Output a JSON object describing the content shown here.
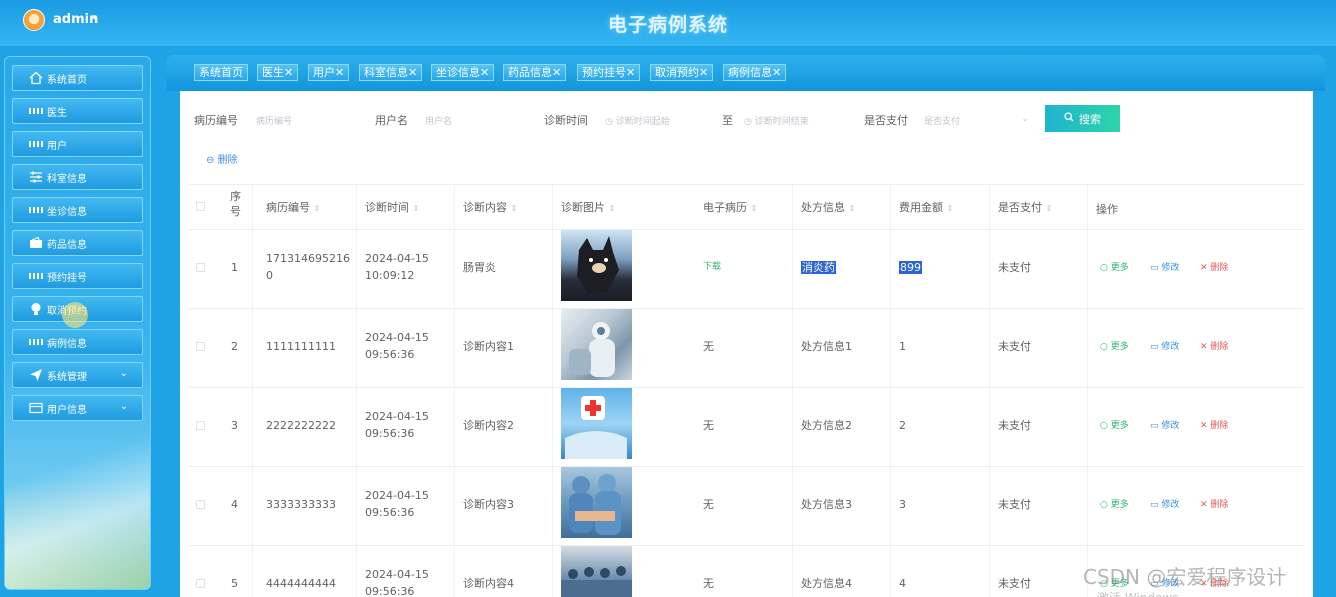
{
  "header": {
    "user": "admin",
    "caret": "▾",
    "title": "电子病例系统"
  },
  "sidebar": {
    "items": [
      {
        "label": "系统首页",
        "icon": "home-icon"
      },
      {
        "label": "医生",
        "icon": "grid-icon"
      },
      {
        "label": "用户",
        "icon": "grid-icon"
      },
      {
        "label": "科室信息",
        "icon": "sliders-icon"
      },
      {
        "label": "坐诊信息",
        "icon": "grid-icon"
      },
      {
        "label": "药品信息",
        "icon": "wallet-icon"
      },
      {
        "label": "预约挂号",
        "icon": "grid-icon"
      },
      {
        "label": "取消预约",
        "icon": "bulb-icon"
      },
      {
        "label": "病例信息",
        "icon": "grid-icon"
      },
      {
        "label": "系统管理",
        "icon": "send-icon",
        "expandable": true
      },
      {
        "label": "用户信息",
        "icon": "card-icon",
        "expandable": true
      }
    ]
  },
  "tabs": [
    {
      "label": "系统首页",
      "close": ""
    },
    {
      "label": "医生",
      "close": "✕"
    },
    {
      "label": "用户",
      "close": "✕"
    },
    {
      "label": "科室信息",
      "close": "✕"
    },
    {
      "label": "坐诊信息",
      "close": "✕"
    },
    {
      "label": "药品信息",
      "close": "✕"
    },
    {
      "label": "预约挂号",
      "close": "✕"
    },
    {
      "label": "取消预约",
      "close": "✕"
    },
    {
      "label": "病例信息",
      "close": "✕"
    }
  ],
  "search": {
    "record_no_label": "病历编号",
    "record_no_placeholder": "病历编号",
    "username_label": "用户名",
    "username_placeholder": "用户名",
    "time_label": "诊断时间",
    "time_start_placeholder": "诊断时间起始",
    "to_label": "至",
    "time_end_placeholder": "诊断时间结束",
    "paid_label": "是否支付",
    "paid_placeholder": "是否支付",
    "button": "搜索"
  },
  "actions": {
    "delete": "删除"
  },
  "table": {
    "columns": [
      "序号",
      "病历编号",
      "诊断时间",
      "诊断内容",
      "诊断图片",
      "电子病历",
      "处方信息",
      "费用金额",
      "是否支付",
      "操作"
    ],
    "op_more": "更多",
    "op_edit": "修改",
    "op_delete": "删除",
    "rows": [
      {
        "idx": "1",
        "no": "1713146952160",
        "time": "2024-04-15 10:09:12",
        "content": "肠胃炎",
        "file": "下载",
        "rx": "消炎药",
        "fee": "899",
        "paid": "未支付"
      },
      {
        "idx": "2",
        "no": "1111111111",
        "time": "2024-04-15 09:56:36",
        "content": "诊断内容1",
        "file": "无",
        "rx": "处方信息1",
        "fee": "1",
        "paid": "未支付"
      },
      {
        "idx": "3",
        "no": "2222222222",
        "time": "2024-04-15 09:56:36",
        "content": "诊断内容2",
        "file": "无",
        "rx": "处方信息2",
        "fee": "2",
        "paid": "未支付"
      },
      {
        "idx": "4",
        "no": "3333333333",
        "time": "2024-04-15 09:56:36",
        "content": "诊断内容3",
        "file": "无",
        "rx": "处方信息3",
        "fee": "3",
        "paid": "未支付"
      },
      {
        "idx": "5",
        "no": "4444444444",
        "time": "2024-04-15 09:56:36",
        "content": "诊断内容4",
        "file": "无",
        "rx": "处方信息4",
        "fee": "4",
        "paid": "未支付"
      }
    ]
  },
  "watermark": "CSDN @宏爱程序设计",
  "watermark2": "激活 Windows"
}
